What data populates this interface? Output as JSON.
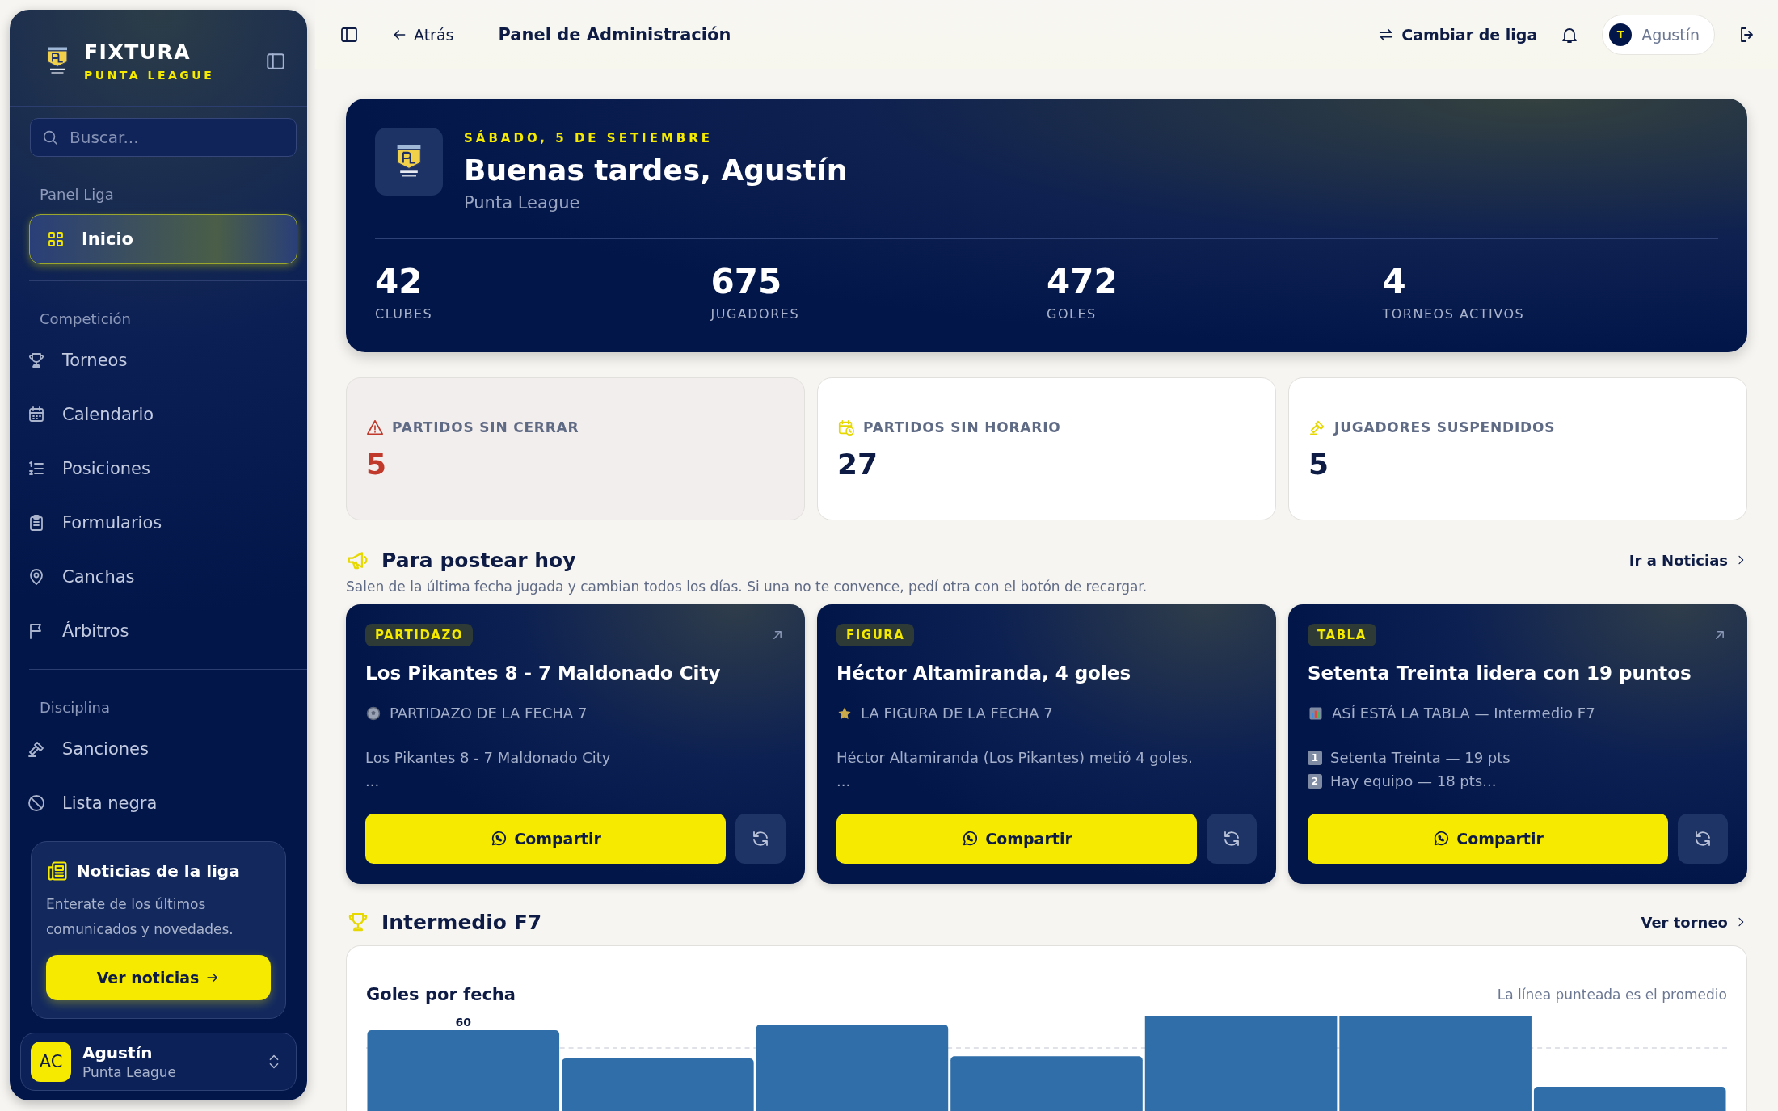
{
  "sidebar": {
    "brand": {
      "title": "FIXTURA",
      "subtitle": "PUNTA LEAGUE"
    },
    "search": {
      "placeholder": "Buscar..."
    },
    "sections": [
      {
        "title": "Panel Liga",
        "items": [
          {
            "label": "Inicio",
            "selected": true
          }
        ]
      },
      {
        "title": "Competición",
        "items": [
          {
            "label": "Torneos",
            "selected": false
          },
          {
            "label": "Calendario",
            "selected": false
          },
          {
            "label": "Posiciones",
            "selected": false
          },
          {
            "label": "Formularios",
            "selected": false
          },
          {
            "label": "Canchas",
            "selected": false
          },
          {
            "label": "Árbitros",
            "selected": false
          }
        ]
      },
      {
        "title": "Disciplina",
        "items": [
          {
            "label": "Sanciones",
            "selected": false
          },
          {
            "label": "Lista negra",
            "selected": false
          }
        ]
      }
    ],
    "promo": {
      "title": "Noticias de la liga",
      "text": "Enterate de los últimos comunicados y novedades.",
      "button": "Ver noticias"
    },
    "user": {
      "initials": "AC",
      "name": "Agustín",
      "org": "Punta League"
    }
  },
  "header": {
    "back": "Atrás",
    "title": "Panel de Administración",
    "switch": "Cambiar de liga",
    "user": {
      "initial": "T",
      "name": "Agustín"
    }
  },
  "hero": {
    "date": "SÁBADO, 5 DE SETIEMBRE",
    "greeting": "Buenas tardes, Agustín",
    "league": "Punta League",
    "stats": [
      {
        "value": "42",
        "label": "CLUBES"
      },
      {
        "value": "675",
        "label": "JUGADORES"
      },
      {
        "value": "472",
        "label": "GOLES"
      },
      {
        "value": "4",
        "label": "TORNEOS ACTIVOS"
      }
    ]
  },
  "alerts": [
    {
      "kind": "danger",
      "label": "PARTIDOS SIN CERRAR",
      "value": "5"
    },
    {
      "kind": "schedule",
      "label": "PARTIDOS SIN HORARIO",
      "value": "27"
    },
    {
      "kind": "suspended",
      "label": "JUGADORES SUSPENDIDOS",
      "value": "5"
    }
  ],
  "posts": {
    "title": "Para postear hoy",
    "link": "Ir a Noticias",
    "subtitle": "Salen de la última fecha jugada y cambian todos los días. Si una no te convence, pedí otra con el botón de recargar.",
    "cards": [
      {
        "tag": "PARTIDAZO",
        "external": true,
        "title": "Los Pikantes 8 - 7 Maldonado City",
        "kicker": "PARTIDAZO DE LA FECHA 7",
        "lines": [
          {
            "text": "Los Pikantes 8 - 7 Maldonado City"
          },
          {
            "text": "..."
          }
        ],
        "button": "Compartir"
      },
      {
        "tag": "FIGURA",
        "external": false,
        "title": "Héctor Altamiranda, 4 goles",
        "kicker": "LA FIGURA DE LA FECHA 7",
        "lines": [
          {
            "text": "Héctor Altamiranda (Los Pikantes) metió 4 goles."
          },
          {
            "text": "..."
          }
        ],
        "button": "Compartir"
      },
      {
        "tag": "TABLA",
        "external": true,
        "title": "Setenta Treinta lidera con 19 puntos",
        "kicker": "ASÍ ESTÁ LA TABLA — Intermedio F7",
        "lines": [
          {
            "marker": "1",
            "text": "Setenta Treinta — 19 pts"
          },
          {
            "marker": "2",
            "text": "Hay equipo — 18 pts..."
          }
        ],
        "button": "Compartir"
      }
    ]
  },
  "tournament": {
    "title": "Intermedio F7",
    "link": "Ver torneo",
    "chart": {
      "title": "Goles por fecha",
      "note": "La línea punteada es el promedio",
      "peak_label": "60"
    }
  }
}
